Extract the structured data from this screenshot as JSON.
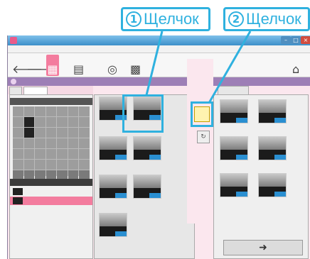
{
  "callouts": [
    {
      "num": "1",
      "text": "Щелчок"
    },
    {
      "num": "2",
      "text": "Щелчок"
    }
  ],
  "colors": {
    "accent": "#2fb1df",
    "pink": "#f37c9e",
    "info_bar": "#9d7fb6"
  },
  "icons": {
    "app": "app-icon",
    "back": "arrow-left-icon",
    "forward": "arrow-right-icon",
    "calendar": "calendar-icon",
    "media": "media-icon",
    "disc": "disc-icon",
    "camera": "camera-icon",
    "home": "home-icon",
    "next": "arrow-right-icon"
  },
  "calendar": {
    "rows": 7,
    "cols": 7
  },
  "center_grid_count": 8,
  "right_grid_count": 6
}
